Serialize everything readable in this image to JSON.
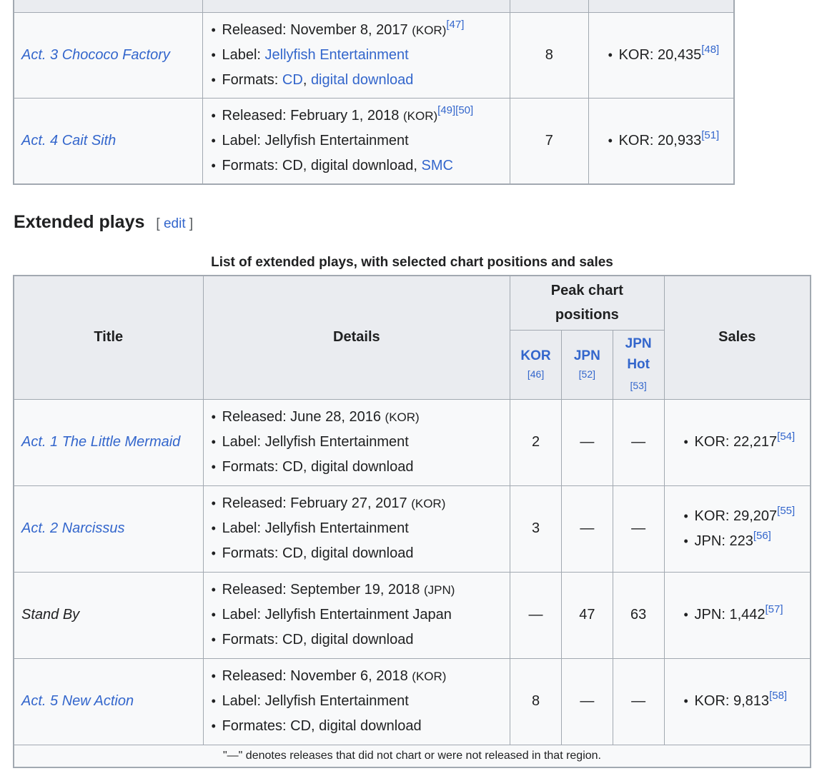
{
  "top_table": {
    "rows": [
      {
        "title": "Act. 3 Chococo Factory",
        "released_prefix": "Released: ",
        "released_date": "November 8, 2017",
        "released_region": "(KOR)",
        "released_refs": "[47]",
        "label_prefix": "Label: ",
        "label": "Jellyfish Entertainment",
        "formats_prefix": "Formats: ",
        "format_cd": "CD",
        "format_sep": ", ",
        "format_dl": "digital download",
        "peak": "8",
        "sales": "KOR: 20,435",
        "sales_ref": "[48]"
      },
      {
        "title": "Act. 4 Cait Sith",
        "released_prefix": "Released: ",
        "released_date": "February 1, 2018",
        "released_region": "(KOR)",
        "released_refs": "[49][50]",
        "label_prefix": "Label: ",
        "label": "Jellyfish Entertainment",
        "formats_text": "Formats: CD, digital download, ",
        "format_smc": "SMC",
        "peak": "7",
        "sales": "KOR: 20,933",
        "sales_ref": "[51]"
      }
    ]
  },
  "section": {
    "heading": "Extended plays",
    "edit_open": "[",
    "edit_label": "edit",
    "edit_close": "]"
  },
  "ep_table": {
    "caption": "List of extended plays, with selected chart positions and sales",
    "headers": {
      "title": "Title",
      "details": "Details",
      "peak_line1": "Peak chart",
      "peak_line2": "positions",
      "sales": "Sales",
      "kor": "KOR",
      "kor_ref": "[46]",
      "jpn": "JPN",
      "jpn_ref": "[52]",
      "jpnhot_line1": "JPN",
      "jpnhot_line2": "Hot",
      "jpnhot_ref": "[53]"
    },
    "rows": [
      {
        "title": "Act. 1 The Little Mermaid",
        "released": "Released: June 28, 2016",
        "region": "(KOR)",
        "label": "Label: Jellyfish Entertainment",
        "formats": "Formats: CD, digital download",
        "kor": "2",
        "jpn": "—",
        "jpnhot": "—",
        "sales": [
          {
            "text": "KOR: 22,217",
            "ref": "[54]"
          }
        ]
      },
      {
        "title": "Act. 2 Narcissus",
        "released": "Released: February 27, 2017",
        "region": "(KOR)",
        "label": "Label: Jellyfish Entertainment",
        "formats": "Formats: CD, digital download",
        "kor": "3",
        "jpn": "—",
        "jpnhot": "—",
        "sales": [
          {
            "text": "KOR: 29,207",
            "ref": "[55]"
          },
          {
            "text": "JPN: 223",
            "ref": "[56]"
          }
        ]
      },
      {
        "title": "Stand By",
        "released": "Released: September 19, 2018",
        "region": "(JPN)",
        "label": "Label: Jellyfish Entertainment Japan",
        "formats": "Formats: CD, digital download",
        "kor": "—",
        "jpn": "47",
        "jpnhot": "63",
        "sales": [
          {
            "text": "JPN: 1,442",
            "ref": "[57]"
          }
        ]
      },
      {
        "title": "Act. 5 New Action",
        "released": "Released: November 6, 2018",
        "region": "(KOR)",
        "label": "Label: Jellyfish Entertainment",
        "formats": "Formates: CD, digital download",
        "kor": "8",
        "jpn": "—",
        "jpnhot": "—",
        "sales": [
          {
            "text": "KOR: 9,813",
            "ref": "[58]"
          }
        ]
      }
    ],
    "footnote": "\"—\" denotes releases that did not chart or were not released in that region."
  }
}
